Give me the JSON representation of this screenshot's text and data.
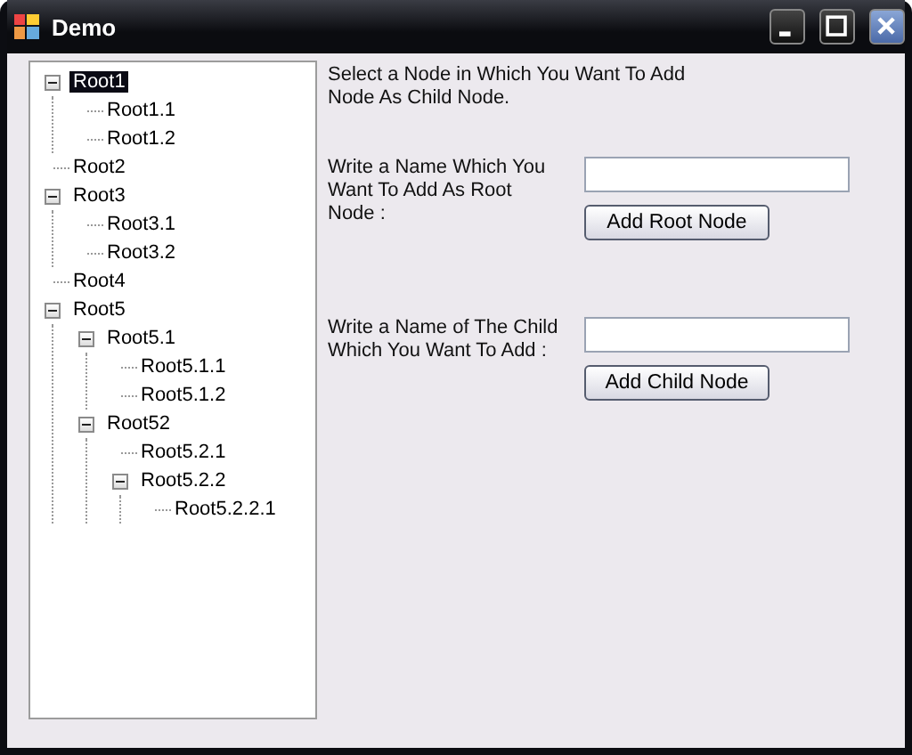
{
  "window": {
    "title": "Demo"
  },
  "tree": [
    {
      "label": "Root1",
      "selected": true,
      "expanded": true,
      "children": [
        {
          "label": "Root1.1",
          "selected": false
        },
        {
          "label": "Root1.2",
          "selected": false
        }
      ]
    },
    {
      "label": "Root2",
      "selected": false
    },
    {
      "label": "Root3",
      "selected": false,
      "expanded": true,
      "children": [
        {
          "label": "Root3.1",
          "selected": false
        },
        {
          "label": "Root3.2",
          "selected": false
        }
      ]
    },
    {
      "label": "Root4",
      "selected": false
    },
    {
      "label": "Root5",
      "selected": false,
      "expanded": true,
      "children": [
        {
          "label": "Root5.1",
          "selected": false,
          "expanded": true,
          "children": [
            {
              "label": "Root5.1.1",
              "selected": false
            },
            {
              "label": "Root5.1.2",
              "selected": false
            }
          ]
        },
        {
          "label": "Root52",
          "selected": false,
          "expanded": true,
          "children": [
            {
              "label": "Root5.2.1",
              "selected": false
            },
            {
              "label": "Root5.2.2",
              "selected": false,
              "expanded": true,
              "children": [
                {
                  "label": "Root5.2.2.1",
                  "selected": false
                }
              ]
            }
          ]
        }
      ]
    }
  ],
  "instruction": "Select a Node in Which You Want To Add Node As Child Node.",
  "root_form": {
    "label": "Write a Name Which You Want To Add As  Root Node :",
    "button": "Add Root Node"
  },
  "child_form": {
    "label": "Write a Name of The Child Which You Want To Add :",
    "button": "Add Child Node"
  }
}
